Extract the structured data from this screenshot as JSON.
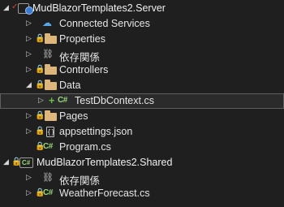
{
  "tree": {
    "server_project": "MudBlazorTemplates2.Server",
    "connected_services": "Connected Services",
    "properties": "Properties",
    "dependencies": "依存関係",
    "controllers": "Controllers",
    "data": "Data",
    "testdb": "TestDbContext.cs",
    "pages": "Pages",
    "appsettings": "appsettings.json",
    "program": "Program.cs",
    "shared_project": "MudBlazorTemplates2.Shared",
    "shared_dependencies": "依存関係",
    "weather": "WeatherForecast.cs"
  },
  "icons": {
    "expand_collapsed": "▷",
    "expand_open": "◢",
    "lock": "🔒",
    "cs": "C#",
    "json": "{}",
    "plus": "+",
    "check": "✓"
  },
  "colors": {
    "background": "#1f1f1f",
    "selected_row": "#2b2b2b",
    "folder": "#dcb67a",
    "lock_blue": "#4f9bea",
    "cs_green": "#9ad77a"
  }
}
